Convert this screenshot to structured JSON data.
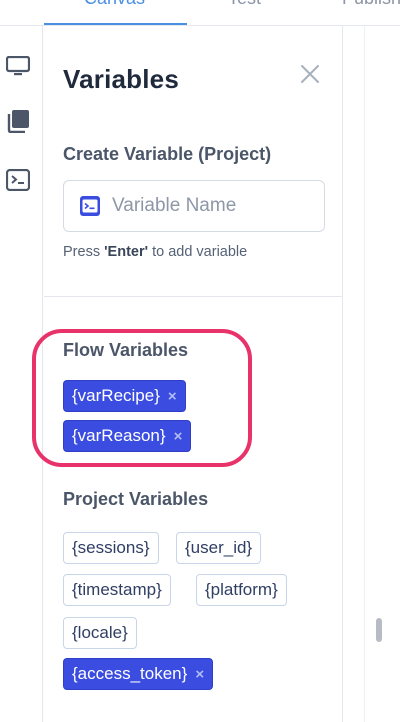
{
  "tabs": {
    "canvas": "Canvas",
    "test": "Test",
    "publish": "Publish"
  },
  "rail": {
    "icons": [
      "monitor-icon",
      "book-icon",
      "terminal-icon"
    ]
  },
  "panel": {
    "title": "Variables",
    "create_heading": "Create Variable (Project)",
    "input_placeholder": "Variable Name",
    "hint_prefix": "Press ",
    "hint_key": "'Enter'",
    "hint_suffix": " to add variable",
    "flow_heading": "Flow Variables",
    "flow_variables": [
      "{varRecipe}",
      "{varReason}"
    ],
    "project_heading": "Project Variables",
    "project_variables": [
      "{sessions}",
      "{user_id}",
      "{timestamp}",
      "{platform}",
      "{locale}",
      "{access_token}"
    ],
    "remove_glyph": "×"
  },
  "colors": {
    "accent": "#4a90e2",
    "chip_active": "#3b4de0",
    "highlight": "#e8336a"
  }
}
